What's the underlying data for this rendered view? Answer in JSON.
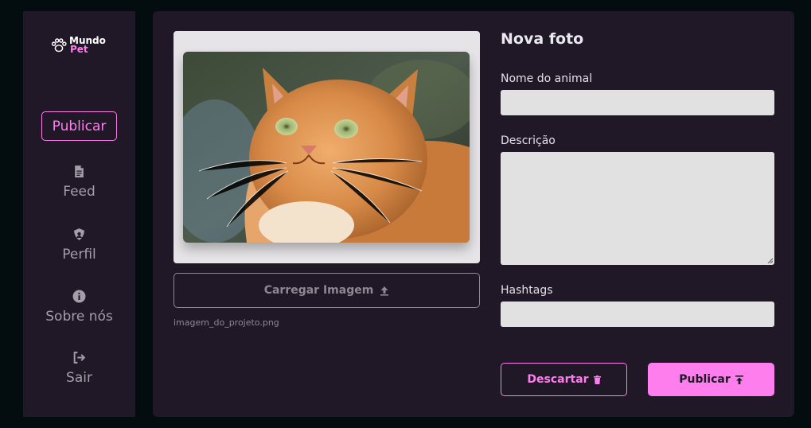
{
  "colors": {
    "page_bg": "#030c0f",
    "panel_bg": "#201827",
    "accent": "#ff7eee",
    "muted": "#8e8893",
    "input_bg": "#e1e1e1"
  },
  "sidebar": {
    "logo": {
      "line1": "Mundo",
      "line2": "Pet",
      "icon": "paw-icon"
    },
    "publish_label": "Publicar",
    "items": [
      {
        "label": "Feed",
        "icon": "document-icon"
      },
      {
        "label": "Perfil",
        "icon": "shield-icon"
      },
      {
        "label": "Sobre nós",
        "icon": "info-icon"
      },
      {
        "label": "Sair",
        "icon": "logout-icon"
      }
    ]
  },
  "preview": {
    "image_alt": "cat-photo",
    "upload_label": "Carregar Imagem",
    "upload_icon": "upload-icon",
    "filename": "imagem_do_projeto.png"
  },
  "form": {
    "title": "Nova foto",
    "fields": {
      "name_label": "Nome do animal",
      "name_value": "",
      "description_label": "Descrição",
      "description_value": "",
      "hashtags_label": "Hashtags",
      "hashtags_value": ""
    },
    "discard_label": "Descartar",
    "discard_icon": "trash-icon",
    "submit_label": "Publicar",
    "submit_icon": "publish-icon"
  }
}
